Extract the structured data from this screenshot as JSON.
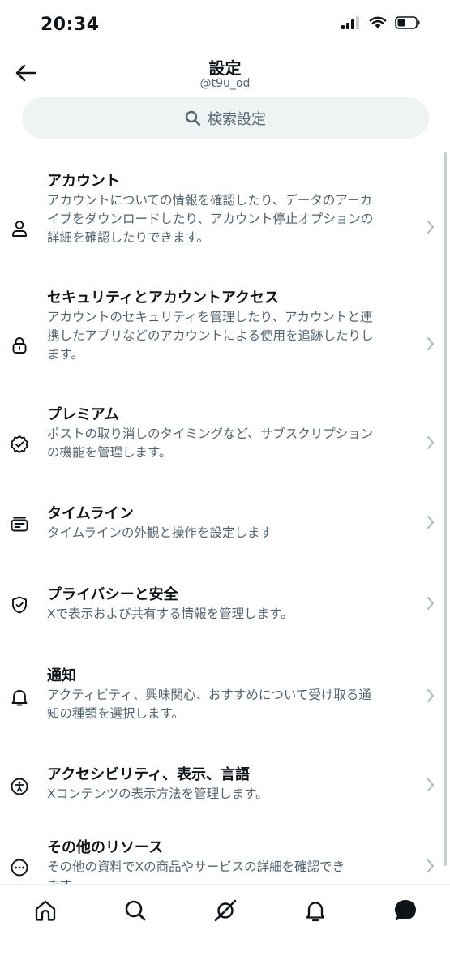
{
  "status_bar": {
    "time": "20:34",
    "icons": [
      "signal-icon",
      "wifi-icon",
      "battery-icon"
    ]
  },
  "header": {
    "title": "設定",
    "handle": "@t9u_od",
    "back_icon": "arrow-left-icon"
  },
  "search": {
    "label": "検索設定",
    "icon": "search-icon"
  },
  "settings_items": [
    {
      "title": "アカウント",
      "desc_lines": [
        "アカウントについての情報を確認したり、データのアーカ",
        "イブをダウンロードしたり、アカウント停止オプションの",
        "詳細を確認したりできます。"
      ],
      "icon": "person-icon"
    },
    {
      "title": "セキュリティとアカウントアクセス",
      "desc_lines": [
        "アカウントのセキュリティを管理したり、アカウントと連",
        "携したアプリなどのアカウントによる使用を追跡したりし",
        "ます。"
      ],
      "icon": "lock-icon"
    },
    {
      "title": "プレミアム",
      "desc_lines": [
        "ポストの取り消しのタイミングなど、サブスクリプション",
        "の機能を管理します。"
      ],
      "icon": "verified-badge-icon"
    },
    {
      "title": "タイムライン",
      "desc_lines": [
        "タイムラインの外観と操作を設定します"
      ],
      "icon": "timeline-card-icon"
    },
    {
      "title": "プライバシーと安全",
      "desc_lines": [
        "Xで表示および共有する情報を管理します。"
      ],
      "icon": "shield-icon"
    },
    {
      "title": "通知",
      "desc_lines": [
        "アクティビティ、興味関心、おすすめについて受け取る通",
        "知の種類を選択します。"
      ],
      "icon": "bell-icon"
    },
    {
      "title": "アクセシビリティ、表示、言語",
      "desc_lines": [
        "Xコンテンツの表示方法を管理します。"
      ],
      "icon": "accessibility-icon"
    },
    {
      "title": "その他のリソース",
      "desc_lines": [
        "その他の資料でXの商品やサービスの詳細を確認でき",
        "ます。"
      ],
      "icon": "more-circle-icon"
    }
  ],
  "bottom_nav": [
    "home-icon",
    "search-icon",
    "grok-icon",
    "notifications-bell-icon",
    "messages-icon"
  ],
  "colors": {
    "text_primary": "#0f1419",
    "text_secondary": "#536471",
    "search_bg": "#eff3f4"
  }
}
